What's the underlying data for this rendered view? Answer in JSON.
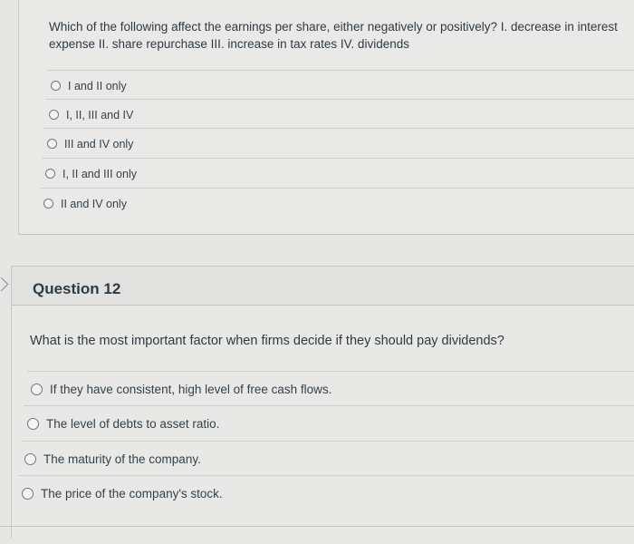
{
  "question11": {
    "prompt": "Which of the following affect the earnings per share, either negatively or positively? I. decrease in interest expense II. share repurchase III. increase in tax rates IV. dividends",
    "answers": [
      {
        "label": "I and II only"
      },
      {
        "label": "I, II, III and IV"
      },
      {
        "label": "III and IV only"
      },
      {
        "label": "I, II and III only"
      },
      {
        "label": "II and IV only"
      }
    ]
  },
  "question12": {
    "title": "Question 12",
    "prompt": "What is the most important factor when firms decide if they should pay dividends?",
    "answers": [
      {
        "label": "If they have consistent, high level of free cash flows."
      },
      {
        "label": "The level of debts to asset ratio."
      },
      {
        "label": "The maturity of the company."
      },
      {
        "label": "The price of the company's stock."
      }
    ]
  }
}
